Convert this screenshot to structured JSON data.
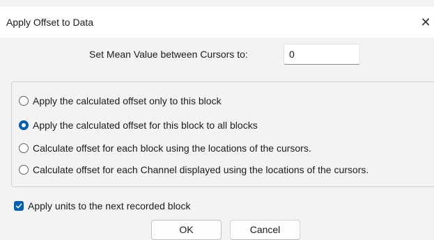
{
  "dialog": {
    "title": "Apply Offset to Data",
    "close_glyph": "✕",
    "close_icon": "close-icon"
  },
  "mean": {
    "label": "Set Mean Value between Cursors to:",
    "value": "0"
  },
  "options": [
    {
      "label": "Apply the calculated offset only to this block",
      "checked": false
    },
    {
      "label": "Apply the calculated offset for this block to all blocks",
      "checked": true
    },
    {
      "label": "Calculate offset for each block using the locations of the cursors.",
      "checked": false
    },
    {
      "label": "Calculate offset for each Channel displayed using the locations of the cursors.",
      "checked": false
    }
  ],
  "units_checkbox": {
    "label": "Apply units to the next recorded block",
    "checked": true
  },
  "buttons": {
    "ok": "OK",
    "cancel": "Cancel"
  },
  "colors": {
    "accent": "#005fb8",
    "dialog_bg": "#f3f3f3",
    "titlebar_bg": "#ffffff"
  }
}
